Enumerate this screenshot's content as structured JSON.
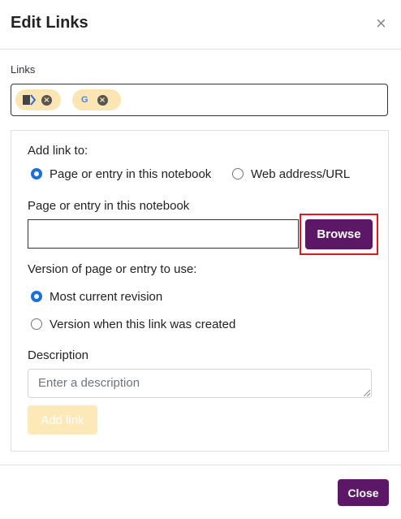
{
  "modal": {
    "title": "Edit Links",
    "close_glyph": "×"
  },
  "links": {
    "label": "Links",
    "chips": [
      {
        "icon": "notebook-entry-icon",
        "remove_glyph": "×"
      },
      {
        "icon": "google-icon",
        "icon_text": "G",
        "remove_glyph": "×"
      }
    ]
  },
  "add_link": {
    "heading": "Add link to:",
    "options": [
      {
        "label": "Page or entry in this notebook",
        "selected": true
      },
      {
        "label": "Web address/URL",
        "selected": false
      }
    ],
    "page_field_label": "Page or entry in this notebook",
    "page_field_value": "",
    "browse_label": "Browse",
    "version_heading": "Version of page or entry to use:",
    "version_options": [
      {
        "label": "Most current revision",
        "selected": true
      },
      {
        "label": "Version when this link was created",
        "selected": false
      }
    ],
    "description_label": "Description",
    "description_placeholder": "Enter a description",
    "add_button_label": "Add link"
  },
  "footer": {
    "close_label": "Close"
  },
  "colors": {
    "accent": "#5c1766",
    "radio_selected": "#1a6fe0",
    "chip_bg": "#fbe5b3",
    "highlight": "#e0161a"
  }
}
